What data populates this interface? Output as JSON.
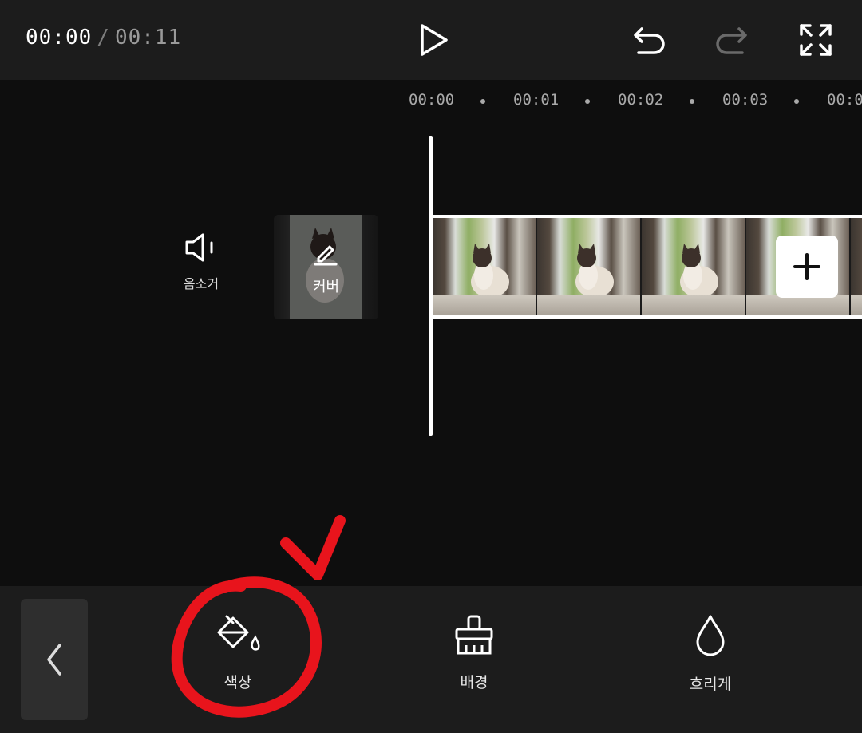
{
  "header": {
    "current_time": "00:00",
    "separator": "/",
    "total_time": "00:11",
    "icons": [
      "play-icon",
      "undo-icon",
      "redo-icon",
      "fullscreen-icon"
    ]
  },
  "ruler": {
    "labels": [
      "00:00",
      "00:01",
      "00:02",
      "00:03",
      "00:0"
    ]
  },
  "track": {
    "mute_label": "음소거",
    "cover_label": "커버",
    "add_icon": "plus-icon"
  },
  "toolbar": {
    "tools": [
      {
        "label": "색상",
        "icon": "paint-bucket-icon"
      },
      {
        "label": "배경",
        "icon": "brush-icon"
      },
      {
        "label": "흐리게",
        "icon": "drop-icon"
      }
    ],
    "back_icon": "chevron-left-icon"
  },
  "colors": {
    "top_bar": "#1c1c1c",
    "canvas": "#0e0e0e",
    "annotation": "#e8141c"
  }
}
